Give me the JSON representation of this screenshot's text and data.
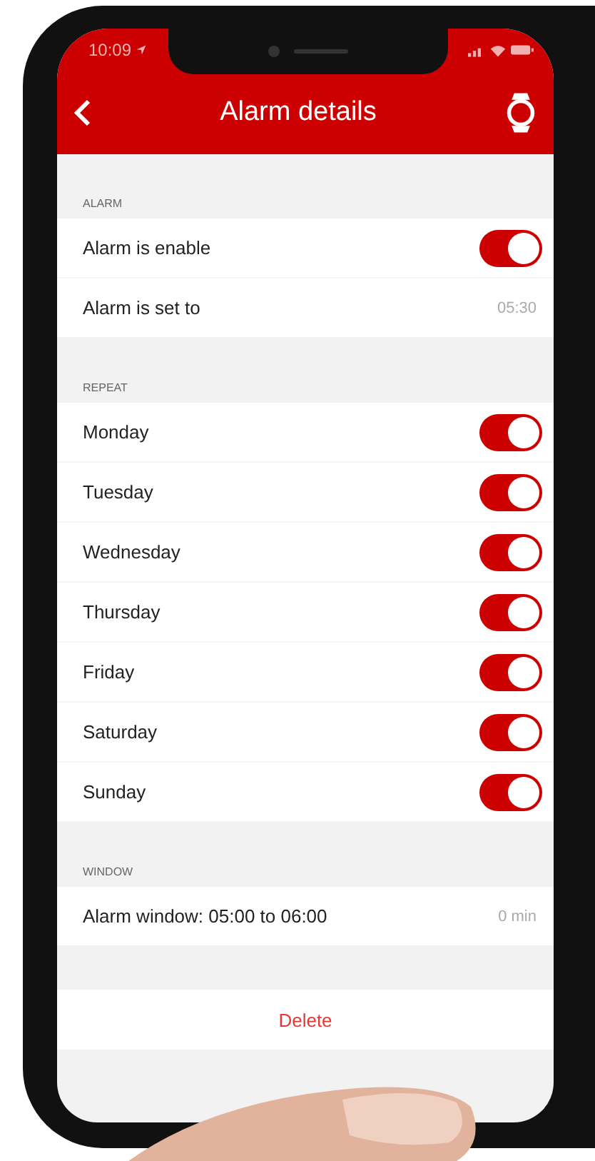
{
  "status_bar": {
    "time": "10:09"
  },
  "nav": {
    "title": "Alarm details"
  },
  "sections": [
    {
      "header": "ALARM",
      "rows": [
        {
          "kind": "toggle",
          "label": "Alarm is enable",
          "on": true
        },
        {
          "kind": "value",
          "label": "Alarm is set to",
          "value": "05:30"
        }
      ]
    },
    {
      "header": "REPEAT",
      "rows": [
        {
          "kind": "toggle",
          "label": "Monday",
          "on": true
        },
        {
          "kind": "toggle",
          "label": "Tuesday",
          "on": true
        },
        {
          "kind": "toggle",
          "label": "Wednesday",
          "on": true
        },
        {
          "kind": "toggle",
          "label": "Thursday",
          "on": true
        },
        {
          "kind": "toggle",
          "label": "Friday",
          "on": true
        },
        {
          "kind": "toggle",
          "label": "Saturday",
          "on": true
        },
        {
          "kind": "toggle",
          "label": "Sunday",
          "on": true
        }
      ]
    },
    {
      "header": "WINDOW",
      "rows": [
        {
          "kind": "value",
          "label": "Alarm window: 05:00 to 06:00",
          "value": "0 min"
        }
      ]
    }
  ],
  "delete_button": "Delete"
}
